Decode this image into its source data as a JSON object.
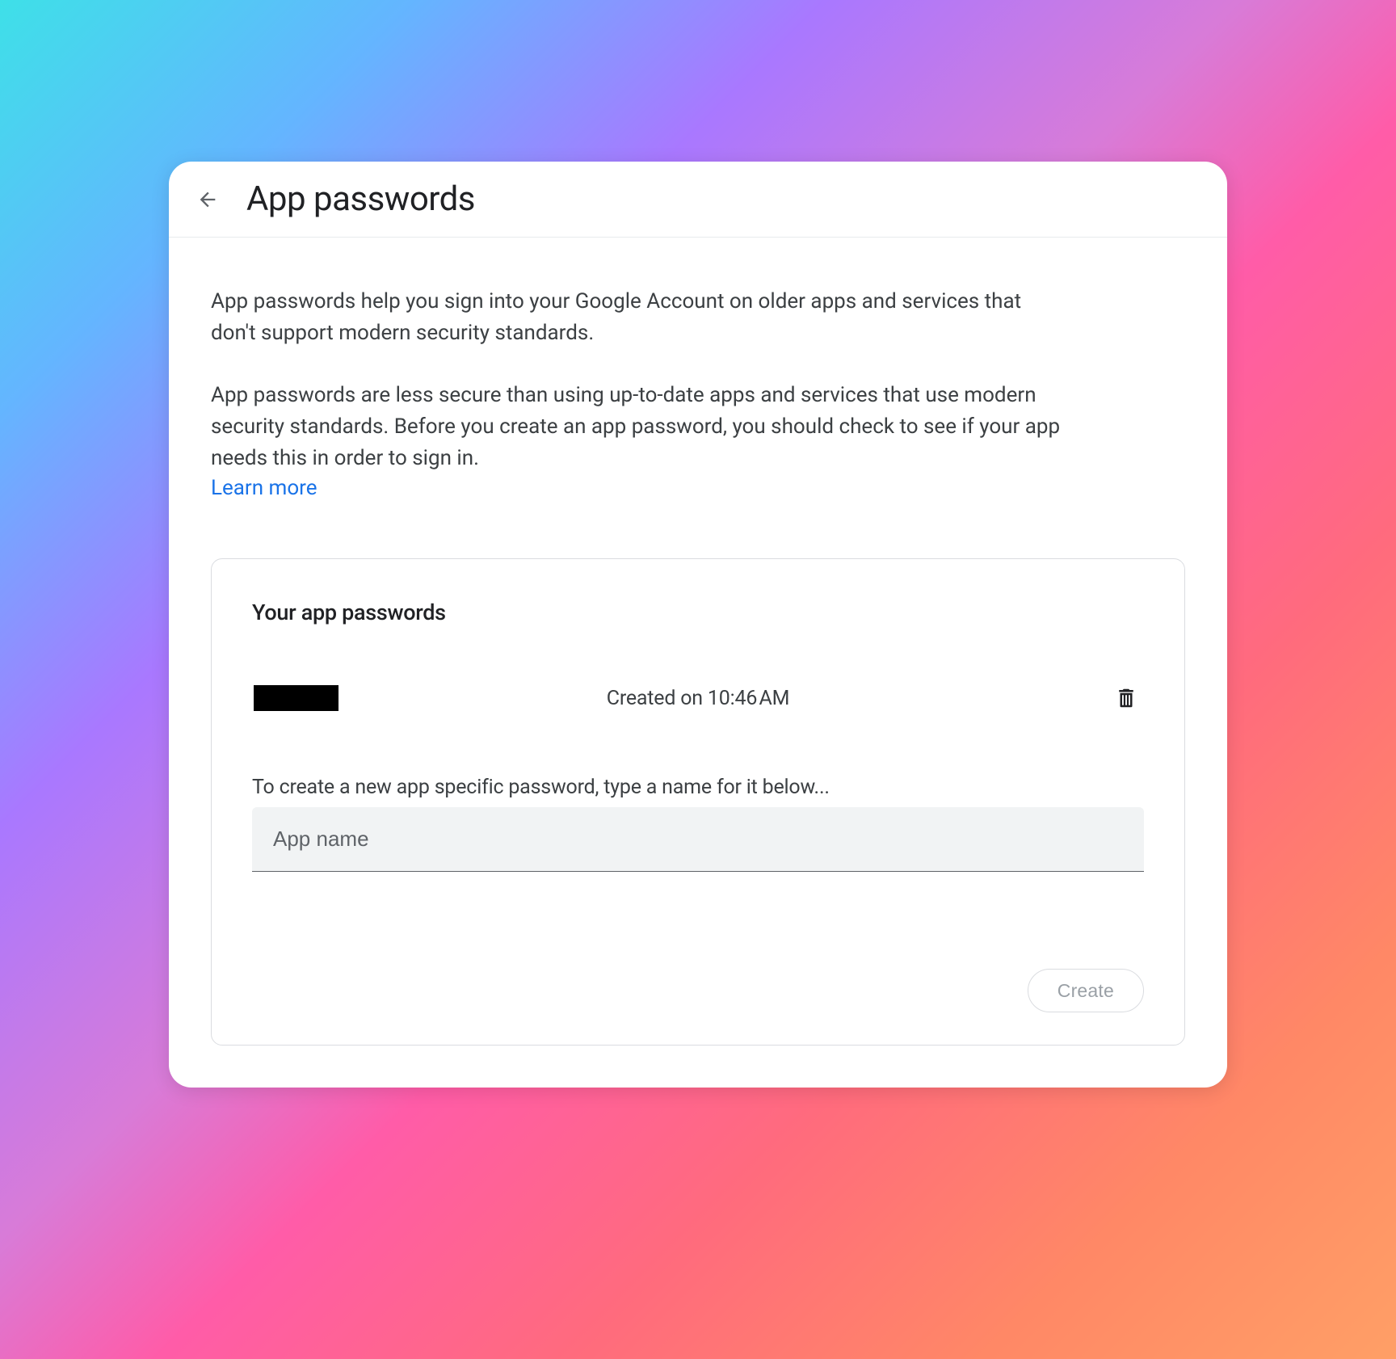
{
  "header": {
    "title": "App passwords"
  },
  "intro": {
    "paragraph1": "App passwords help you sign into your Google Account on older apps and services that don't support modern security standards.",
    "paragraph2": "App passwords are less secure than using up-to-date apps and services that use modern security standards. Before you create an app password, you should check to see if your app needs this in order to sign in.",
    "learn_more": "Learn more"
  },
  "panel": {
    "title": "Your app passwords",
    "items": [
      {
        "created_label": "Created on 10:46 AM"
      }
    ],
    "instruction": "To create a new app specific password, type a name for it below...",
    "input_placeholder": "App name",
    "create_label": "Create"
  }
}
